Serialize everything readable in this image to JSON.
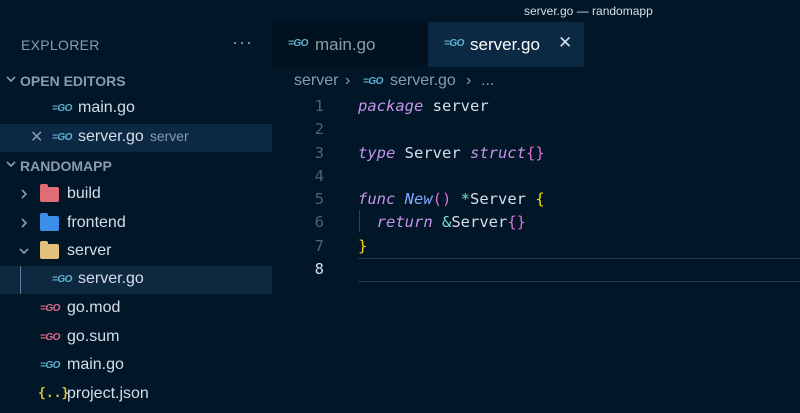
{
  "window": {
    "title": "server.go — randomapp"
  },
  "explorer": {
    "title": "EXPLORER",
    "more_icon": "ellipsis-icon",
    "open_editors": {
      "title": "OPEN EDITORS",
      "items": [
        {
          "label": "main.go",
          "icon": "go-file-icon",
          "desc": ""
        },
        {
          "label": "server.go",
          "icon": "go-file-icon",
          "desc": "server"
        }
      ]
    },
    "project": {
      "title": "RANDOMAPP",
      "items": [
        {
          "label": "build",
          "icon": "folder-icon"
        },
        {
          "label": "frontend",
          "icon": "folder-icon"
        },
        {
          "label": "server",
          "icon": "folder-open-icon"
        },
        {
          "label": "server.go",
          "icon": "go-file-icon"
        },
        {
          "label": "go.mod",
          "icon": "go-mod-icon"
        },
        {
          "label": "go.sum",
          "icon": "go-mod-icon"
        },
        {
          "label": "main.go",
          "icon": "go-file-icon"
        },
        {
          "label": "project.json",
          "icon": "json-icon"
        }
      ]
    }
  },
  "tabs": [
    {
      "label": "main.go",
      "active": false
    },
    {
      "label": "server.go",
      "active": true
    }
  ],
  "breadcrumb": {
    "folder": "server",
    "file": "server.go",
    "symbol": "..."
  },
  "editor": {
    "line_numbers": [
      "1",
      "2",
      "3",
      "4",
      "5",
      "6",
      "7",
      "8"
    ],
    "current_line": 8,
    "tokens": {
      "l1_kw": "package",
      "l1_name": " server",
      "l3_kw": "type",
      "l3_name": " Server ",
      "l3_kw2": "struct",
      "l3_brace": "{}",
      "l5_kw": "func",
      "l5_fn": " New",
      "l5_paren": "()",
      "l5_op": " *",
      "l5_type": "Server ",
      "l5_brace": "{",
      "l6_kw": "return",
      "l6_op": " &",
      "l6_type": "Server",
      "l6_brace": "{}",
      "l7_brace": "}"
    }
  },
  "colors": {
    "background": "#011627",
    "sidebar_selected": "#0b2942",
    "keyword": "#c792ea",
    "function": "#82aaff",
    "brace_gold": "#ffd700",
    "brace_purple": "#da70d6",
    "operator": "#7fdbca",
    "go_icon": "#5fb3d4",
    "go_mod_icon": "#e06c8c",
    "folder_build": "#e06c75",
    "folder_frontend": "#3b8eea",
    "folder_server": "#e5c07b",
    "json_icon": "#d4c241"
  }
}
